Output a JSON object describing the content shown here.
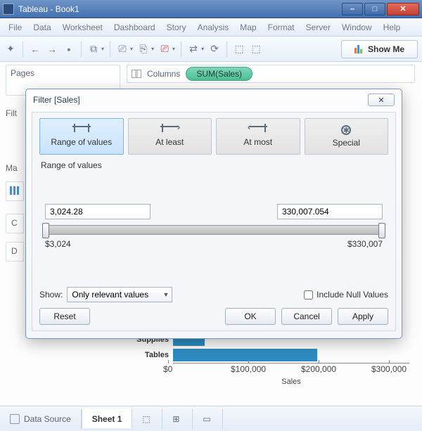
{
  "window": {
    "title": "Tableau - Book1"
  },
  "menu": [
    "File",
    "Data",
    "Worksheet",
    "Dashboard",
    "Story",
    "Analysis",
    "Map",
    "Format",
    "Server",
    "Window",
    "Help"
  ],
  "showme_label": "Show Me",
  "pages_label": "Pages",
  "columns_label": "Columns",
  "pill_label": "SUM(Sales)",
  "left_labels": {
    "filters": "Filt",
    "marks": "Ma",
    "c": "C",
    "d": "D"
  },
  "chart_data": {
    "type": "bar",
    "categories": [
      "Supplies",
      "Tables"
    ],
    "values": [
      45000,
      205000
    ],
    "xlabel": "Sales",
    "xticks": [
      0,
      100000,
      200000,
      300000
    ],
    "xtick_labels": [
      "$0",
      "$100,000",
      "$200,000",
      "$300,000"
    ],
    "xlim": [
      0,
      330000
    ]
  },
  "dialog": {
    "title": "Filter [Sales]",
    "tabs": [
      "Range of values",
      "At least",
      "At most",
      "Special"
    ],
    "active_tab": "Range of values",
    "section": "Range of values",
    "min_input": "3,024.28",
    "max_input": "330,007.054",
    "min_label": "$3,024",
    "max_label": "$330,007",
    "show_label": "Show:",
    "show_select": "Only relevant values",
    "include_null_label": "Include Null Values",
    "reset": "Reset",
    "ok": "OK",
    "cancel": "Cancel",
    "apply": "Apply"
  },
  "bottom": {
    "data_source": "Data Source",
    "sheet": "Sheet 1"
  }
}
